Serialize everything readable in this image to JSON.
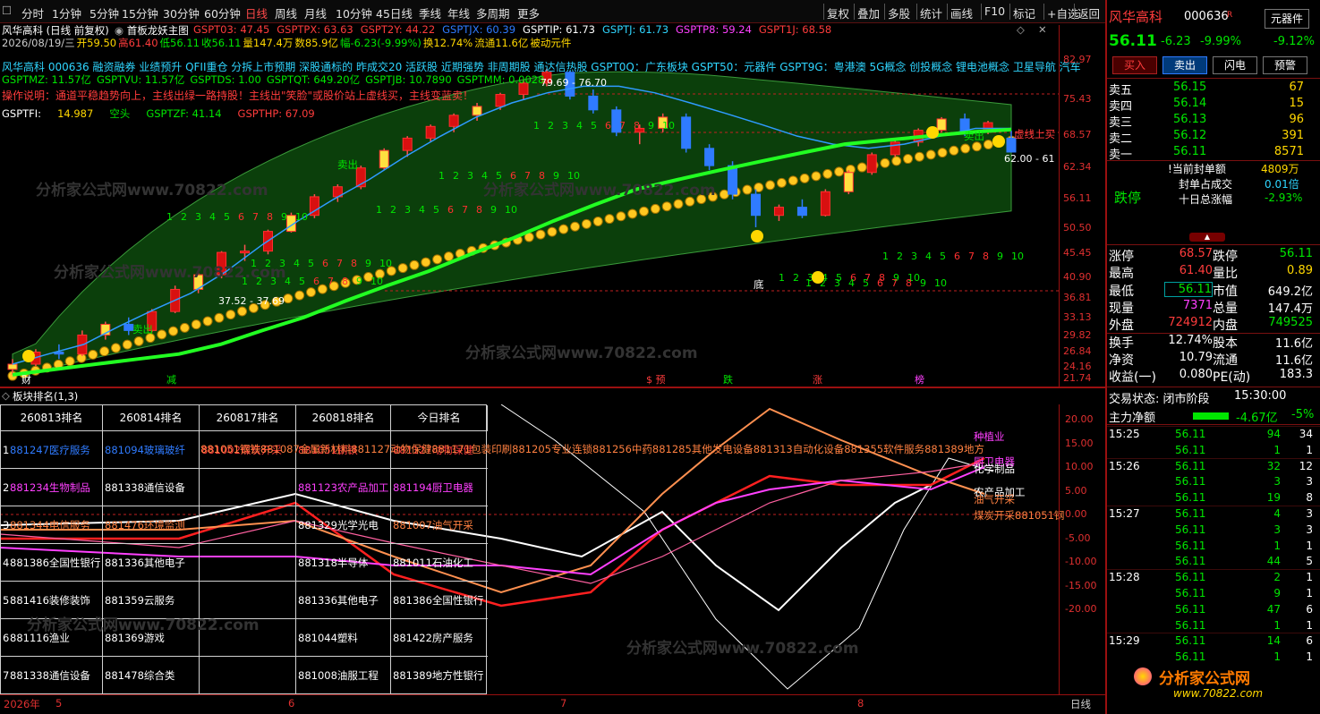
{
  "toolbar": {
    "left": [
      "分时",
      "1分钟",
      "5分钟",
      "15分钟",
      "30分钟",
      "60分钟",
      "日线",
      "周线",
      "月线",
      "10分钟",
      "45日线",
      "季线",
      "年线",
      "多周期",
      "更多"
    ],
    "active": "日线",
    "right": [
      "复权",
      "叠加",
      "多股",
      "统计",
      "画线",
      "F10",
      "标记",
      "+自选",
      "返回"
    ]
  },
  "chart": {
    "title": "风华高科 (日线 前复权)",
    "indicator_name": "首板龙妖主图",
    "line1": [
      {
        "t": "GSPT03: 47.45",
        "c": "#ff3c3c"
      },
      {
        "t": "GSPTPX: 63.63",
        "c": "#ff3c3c"
      },
      {
        "t": "GSPT2Y: 44.22",
        "c": "#ff3c3c"
      },
      {
        "t": "GSPTJX: 60.39",
        "c": "#2f7bff"
      },
      {
        "t": "GSPTIP: 61.73",
        "c": "#ffffff"
      },
      {
        "t": "GSPTJ: 61.73",
        "c": "#2fd6ff"
      },
      {
        "t": "GSPTP8: 59.24",
        "c": "#ff40ff"
      },
      {
        "t": "GSPT1J: 68.58",
        "c": "#ff3c3c"
      }
    ],
    "line2": [
      {
        "t": "2026/08/19/三",
        "c": "#ccc"
      },
      {
        "t": "开59.50",
        "c": "#ffd700"
      },
      {
        "t": "高61.40",
        "c": "#ff3c3c"
      },
      {
        "t": "低56.11",
        "c": "#00e600"
      },
      {
        "t": "收56.11",
        "c": "#00e600"
      },
      {
        "t": "量147.4万",
        "c": "#ffd700"
      },
      {
        "t": "数85.9亿",
        "c": "#ffd700"
      },
      {
        "t": "幅-6.23(-9.99%)",
        "c": "#00e600"
      },
      {
        "t": "换12.74%",
        "c": "#ffd700"
      },
      {
        "t": "流通11.6亿",
        "c": "#ffd700"
      },
      {
        "t": "被动元件",
        "c": "#ffd700"
      }
    ],
    "line3": "风华高科 000636 融资融券 业绩预升 QFII重仓 分拆上市预期 深股通标的 昨成交20 活跃股 近期强势 非周期股 通达信热股 GSPT0Q：广东板块 GSPT50：元器件 GSPT9G：粤港澳 5G概念 创投概念 锂电池概念 卫星导航 汽车",
    "line4": "操作说明：通道平稳趋势向上，主线出绿一路持股！主线出\"笑脸\"或股价站上虚线买，主线变蓝卖！",
    "line5": [
      {
        "t": "GSPTMZ: 11.57亿",
        "c": "#00e600"
      },
      {
        "t": "GSPTVU: 11.57亿",
        "c": "#00e600"
      },
      {
        "t": "GSPTDS: 1.00",
        "c": "#00e600"
      },
      {
        "t": "GSPTQT: 649.20亿",
        "c": "#00e600"
      },
      {
        "t": "GSPTJB: 10.7890",
        "c": "#00e600"
      },
      {
        "t": "GSPTMM: 0.0028",
        "c": "#00e600"
      }
    ],
    "line6": [
      {
        "t": "GSPTFI:",
        "c": "#fff"
      },
      {
        "t": "14.987",
        "c": "#ffd700"
      },
      {
        "t": "空头",
        "c": "#00e600"
      },
      {
        "t": "GSPTZF: 41.14",
        "c": "#00e600"
      },
      {
        "t": "GSPTHP: 67.09",
        "c": "#ff3c3c"
      }
    ],
    "labels": {
      "sell1": "卖出",
      "sell2": "卖出",
      "sell3": "卖出",
      "bottom": "底",
      "buy_line": "虚线上买",
      "high_mark": "79.69",
      "high_mark2": "76.70",
      "low_mark": "37.52",
      "low_mark2": "37.69",
      "right_mark": "62.00 - 61"
    },
    "events": [
      {
        "t": "财",
        "c": "#fff"
      },
      {
        "t": "减",
        "c": "#00e600"
      },
      {
        "t": "$ 预",
        "c": "#ff3c3c"
      },
      {
        "t": "跌",
        "c": "#00e600"
      },
      {
        "t": "涨",
        "c": "#ff3c3c"
      },
      {
        "t": "榜",
        "c": "#ff40ff"
      }
    ],
    "yaxis": [
      "82.97",
      "75.43",
      "68.57",
      "62.34",
      "56.11",
      "50.50",
      "45.45",
      "40.90",
      "36.81",
      "33.13",
      "29.82",
      "26.84",
      "24.16",
      "21.74"
    ],
    "watermark": "分析家公式网www.70822.com"
  },
  "chart_data": {
    "type": "candlestick",
    "x": [
      "2026-05",
      "2026-06",
      "2026-07",
      "2026-08"
    ],
    "ylim": [
      21.74,
      82.97
    ],
    "ohlc": [
      [
        22.5,
        23.5,
        22.0,
        23.0
      ],
      [
        23.0,
        24.5,
        22.8,
        24.2
      ],
      [
        24.2,
        25.0,
        23.5,
        24.0
      ],
      [
        24.0,
        26.5,
        23.8,
        26.0
      ],
      [
        26.0,
        27.5,
        25.5,
        27.2
      ],
      [
        27.2,
        28.0,
        26.0,
        26.5
      ],
      [
        26.5,
        29.0,
        26.3,
        28.7
      ],
      [
        28.7,
        32.0,
        28.5,
        31.5
      ],
      [
        31.5,
        34.0,
        31.0,
        33.5
      ],
      [
        33.5,
        37.0,
        33.0,
        36.8
      ],
      [
        36.8,
        38.0,
        35.5,
        37.0
      ],
      [
        37.0,
        40.5,
        36.5,
        40.2
      ],
      [
        40.2,
        43.5,
        40.0,
        43.0
      ],
      [
        43.0,
        47.0,
        42.5,
        46.5
      ],
      [
        46.5,
        49.0,
        45.5,
        48.5
      ],
      [
        48.5,
        53.0,
        48.0,
        52.5
      ],
      [
        52.5,
        57.0,
        52.0,
        56.5
      ],
      [
        56.5,
        60.0,
        55.0,
        59.5
      ],
      [
        59.5,
        63.0,
        58.5,
        62.5
      ],
      [
        62.5,
        66.0,
        61.0,
        65.5
      ],
      [
        65.5,
        69.0,
        64.0,
        68.0
      ],
      [
        68.0,
        72.0,
        67.0,
        71.5
      ],
      [
        71.5,
        76.0,
        70.0,
        75.0
      ],
      [
        75.0,
        79.7,
        74.0,
        78.5
      ],
      [
        78.5,
        79.0,
        70.0,
        71.0
      ],
      [
        71.0,
        73.0,
        66.0,
        67.0
      ],
      [
        67.0,
        68.0,
        60.0,
        61.0
      ],
      [
        61.0,
        63.0,
        58.0,
        62.0
      ],
      [
        62.0,
        66.0,
        61.0,
        65.0
      ],
      [
        65.0,
        66.0,
        56.0,
        57.0
      ],
      [
        57.0,
        58.0,
        52.0,
        53.0
      ],
      [
        53.0,
        54.0,
        46.0,
        47.0
      ],
      [
        47.0,
        48.0,
        40.9,
        43.0
      ],
      [
        43.0,
        45.0,
        42.0,
        44.5
      ],
      [
        44.5,
        46.0,
        42.5,
        43.0
      ],
      [
        43.0,
        48.0,
        42.8,
        47.5
      ],
      [
        47.5,
        52.0,
        47.0,
        51.5
      ],
      [
        51.5,
        56.0,
        51.0,
        55.5
      ],
      [
        55.5,
        59.0,
        55.0,
        58.5
      ],
      [
        58.5,
        62.0,
        57.5,
        61.5
      ],
      [
        61.5,
        65.0,
        61.0,
        64.5
      ],
      [
        64.5,
        66.0,
        60.0,
        61.0
      ],
      [
        61.0,
        64.0,
        60.5,
        63.5
      ],
      [
        59.5,
        61.4,
        56.11,
        56.11
      ]
    ],
    "series": [
      {
        "name": "GSPTJX",
        "values": [
          23,
          24,
          25,
          27,
          29,
          31,
          34,
          38,
          42,
          46,
          50,
          55,
          60,
          65,
          69,
          72,
          74,
          74,
          72,
          69,
          66,
          63,
          60,
          58,
          57,
          58,
          60,
          62,
          62
        ]
      },
      {
        "name": "GSPTIP",
        "values": [
          22,
          22.5,
          23,
          23.5,
          24,
          25,
          26.5,
          28,
          30,
          32,
          34,
          36.5,
          39,
          42,
          45,
          48,
          50,
          52,
          54,
          56,
          58,
          59,
          60,
          61,
          61.7
        ]
      }
    ]
  },
  "panel2": {
    "title": "板块排名(1,3)",
    "headers": [
      "260813排名",
      "260814排名",
      "260817排名",
      "260818排名",
      "今日排名"
    ],
    "rows": [
      {
        "n": "1",
        "c": [
          "881247医疗服务",
          "881094玻璃玻纤",
          "881002煤炭开采",
          "881051钢铁",
          "881127动物保健"
        ],
        "colors": [
          "#2f7bff",
          "#2f7bff",
          "#ff3c3c",
          "#ff3c3c",
          "#ff3c3c"
        ]
      },
      {
        "n": "2",
        "c": [
          "881234生物制品",
          "881338通信设备",
          "",
          "881123农产品加工",
          "881194厨卫电器"
        ],
        "colors": [
          "#ff40ff",
          "#fff",
          "#fff",
          "#ff40ff",
          "#ff40ff"
        ]
      },
      {
        "n": "3",
        "c": [
          "881344电信服务",
          "881476环境监测",
          "",
          "881329光学光电",
          "881007油气开采"
        ],
        "colors": [
          "#ff8040",
          "#ff8040",
          "#fff",
          "#fff",
          "#ff8040"
        ]
      },
      {
        "n": "4",
        "c": [
          "881386全国性银行",
          "881336其他电子",
          "",
          "881318半导体",
          "881011石油化工"
        ],
        "colors": [
          "#fff",
          "#fff",
          "#fff",
          "#fff",
          "#fff"
        ]
      },
      {
        "n": "5",
        "c": [
          "881416装修装饰",
          "881359云服务",
          "",
          "881336其他电子",
          "881386全国性银行"
        ],
        "colors": [
          "#fff",
          "#fff",
          "#fff",
          "#fff",
          "#fff"
        ]
      },
      {
        "n": "6",
        "c": [
          "881116渔业",
          "881369游戏",
          "",
          "881044塑料",
          "881422房产服务"
        ],
        "colors": [
          "#fff",
          "#fff",
          "#fff",
          "#fff",
          "#fff"
        ]
      },
      {
        "n": "7",
        "c": [
          "881338通信设备",
          "881478综合类",
          "",
          "881008油服工程",
          "881389地方性银行"
        ],
        "colors": [
          "#fff",
          "#fff",
          "#fff",
          "#fff",
          "#fff"
        ]
      }
    ],
    "overflow_text": "881051钢铁881087金属新材料881127动物保健881171包装印刷881205专业连锁881256中药881285其他发电设备881313自动化设备881355软件服务881389地方",
    "legend": [
      {
        "t": "种植业",
        "c": "#ff40ff"
      },
      {
        "t": "厨卫电器",
        "c": "#ff40ff"
      },
      {
        "t": "化学制品",
        "c": "#fff"
      },
      {
        "t": "农产品加工",
        "c": "#fff"
      },
      {
        "t": "油气开采",
        "c": "#ff8040"
      },
      {
        "t": "煤炭开采881051钢",
        "c": "#ff8040"
      }
    ],
    "yaxis": [
      "20.00",
      "15.00",
      "10.00",
      "5.00",
      "0.00",
      "-5.00",
      "-10.00",
      "-15.00",
      "-20.00"
    ]
  },
  "bottom": {
    "year": "2026年",
    "months": [
      "5",
      "6",
      "7",
      "8"
    ],
    "period": "日线"
  },
  "quote": {
    "name": "风华高科",
    "code": "000636",
    "sector": "元器件",
    "price": "56.11",
    "chg": "-6.23",
    "pct": "-9.99%",
    "sector_pct": "-9.12%",
    "buttons": [
      "买入",
      "卖出",
      "闪电",
      "预警"
    ],
    "sell": [
      {
        "l": "卖五",
        "p": "56.15",
        "v": "67"
      },
      {
        "l": "卖四",
        "p": "56.14",
        "v": "15"
      },
      {
        "l": "卖三",
        "p": "56.13",
        "v": "96"
      },
      {
        "l": "卖二",
        "p": "56.12",
        "v": "391"
      },
      {
        "l": "卖一",
        "p": "56.11",
        "v": "8571"
      }
    ],
    "limit": {
      "state": "跌停",
      "a": "当前封单额",
      "av": "4809万",
      "b": "封单占成交",
      "bv": "0.01倍",
      "c": "十日总涨幅",
      "cv": "-2.93%"
    },
    "stats": [
      {
        "l": "涨停",
        "v": "68.57",
        "vc": "#ff3c3c",
        "l2": "跌停",
        "v2": "56.11",
        "v2c": "#00e600"
      },
      {
        "l": "最高",
        "v": "61.40",
        "vc": "#ff3c3c",
        "l2": "量比",
        "v2": "0.89",
        "v2c": "#ffd700"
      },
      {
        "l": "最低",
        "v": "56.11",
        "vc": "#00e600",
        "l2": "市值",
        "v2": "649.2亿",
        "v2c": "#fff"
      },
      {
        "l": "现量",
        "v": "7371",
        "vc": "#ff40ff",
        "l2": "总量",
        "v2": "147.4万",
        "v2c": "#fff"
      },
      {
        "l": "外盘",
        "v": "724912",
        "vc": "#ff3c3c",
        "l2": "内盘",
        "v2": "749525",
        "v2c": "#00e600"
      },
      {
        "l": "换手",
        "v": "12.74%",
        "vc": "#fff",
        "l2": "股本",
        "v2": "11.6亿",
        "v2c": "#fff"
      },
      {
        "l": "净资",
        "v": "10.79",
        "vc": "#fff",
        "l2": "流通",
        "v2": "11.6亿",
        "v2c": "#fff"
      },
      {
        "l": "收益(一)",
        "v": "0.080",
        "vc": "#fff",
        "l2": "PE(动)",
        "v2": "183.3",
        "v2c": "#fff"
      }
    ],
    "trade_state": "交易状态: 闭市阶段",
    "trade_time": "15:30:00",
    "flow_label": "主力净额",
    "flow_val": "-4.67亿",
    "flow_pct": "-5%",
    "ticks": [
      {
        "t": "15:25",
        "p": "56.11",
        "v": "94",
        "n": "34"
      },
      {
        "t": "",
        "p": "56.11",
        "v": "1",
        "n": "1"
      },
      {
        "t": "15:26",
        "p": "56.11",
        "v": "32",
        "n": "12"
      },
      {
        "t": "",
        "p": "56.11",
        "v": "3",
        "n": "3"
      },
      {
        "t": "",
        "p": "56.11",
        "v": "19",
        "n": "8"
      },
      {
        "t": "15:27",
        "p": "56.11",
        "v": "4",
        "n": "3"
      },
      {
        "t": "",
        "p": "56.11",
        "v": "3",
        "n": "3"
      },
      {
        "t": "",
        "p": "56.11",
        "v": "1",
        "n": "1"
      },
      {
        "t": "",
        "p": "56.11",
        "v": "44",
        "n": "5"
      },
      {
        "t": "15:28",
        "p": "56.11",
        "v": "2",
        "n": "1"
      },
      {
        "t": "",
        "p": "56.11",
        "v": "9",
        "n": "1"
      },
      {
        "t": "",
        "p": "56.11",
        "v": "47",
        "n": "6"
      },
      {
        "t": "",
        "p": "56.11",
        "v": "1",
        "n": "1"
      },
      {
        "t": "15:29",
        "p": "56.11",
        "v": "14",
        "n": "6"
      },
      {
        "t": "",
        "p": "56.11",
        "v": "1",
        "n": "1"
      }
    ],
    "logo": "分析家公式网",
    "logo_url": "www.70822.com"
  }
}
